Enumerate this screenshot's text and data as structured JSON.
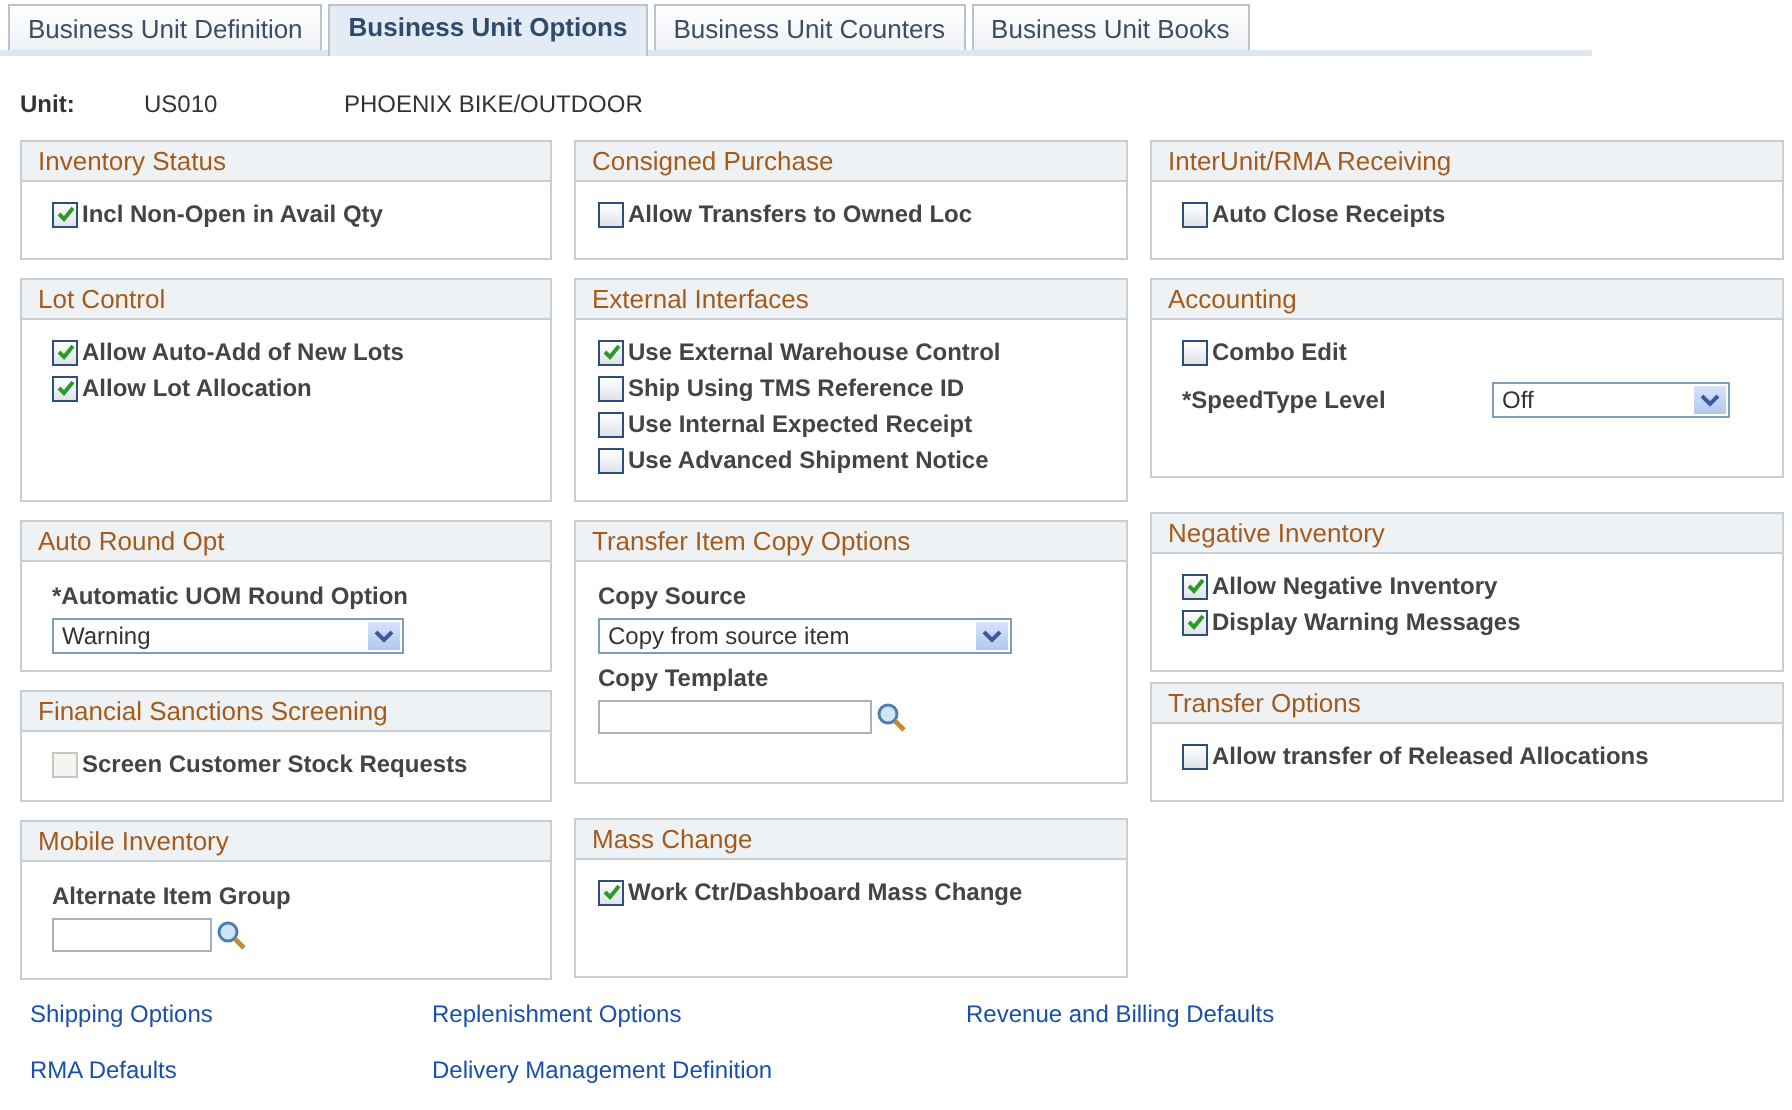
{
  "tabs": [
    {
      "label": "Business Unit Definition",
      "selected": false
    },
    {
      "label": "Business Unit Options",
      "selected": true
    },
    {
      "label": "Business Unit Counters",
      "selected": false
    },
    {
      "label": "Business Unit Books",
      "selected": false
    }
  ],
  "unit": {
    "label": "Unit:",
    "code": "US010",
    "description": "PHOENIX BIKE/OUTDOOR"
  },
  "columns": [
    {
      "groups": [
        {
          "title": "Inventory Status",
          "items": [
            {
              "kind": "checkbox",
              "label": "Incl Non-Open in Avail Qty",
              "checked": true,
              "disabled": false
            }
          ]
        },
        {
          "title": "Lot Control",
          "items": [
            {
              "kind": "checkbox",
              "label": "Allow Auto-Add of New Lots",
              "checked": true,
              "disabled": false
            },
            {
              "kind": "checkbox",
              "label": "Allow Lot Allocation",
              "checked": true,
              "disabled": false
            }
          ]
        },
        {
          "title": "Auto Round Opt",
          "items": [
            {
              "kind": "select",
              "label": "*Automatic UOM Round Option",
              "value": "Warning"
            }
          ]
        },
        {
          "title": "Financial Sanctions Screening",
          "items": [
            {
              "kind": "checkbox",
              "label": "Screen Customer Stock Requests",
              "checked": false,
              "disabled": true
            }
          ]
        },
        {
          "title": "Mobile Inventory",
          "items": [
            {
              "kind": "lookup",
              "label": "Alternate Item Group"
            }
          ]
        }
      ]
    },
    {
      "groups": [
        {
          "title": "Consigned Purchase",
          "items": [
            {
              "kind": "checkbox",
              "label": "Allow Transfers to Owned Loc",
              "checked": false,
              "disabled": false
            }
          ]
        },
        {
          "title": "External Interfaces",
          "items": [
            {
              "kind": "checkbox",
              "label": "Use External Warehouse Control",
              "checked": true,
              "disabled": false
            },
            {
              "kind": "checkbox",
              "label": "Ship Using TMS Reference ID",
              "checked": false,
              "disabled": false
            },
            {
              "kind": "checkbox",
              "label": "Use Internal Expected Receipt",
              "checked": false,
              "disabled": false
            },
            {
              "kind": "checkbox",
              "label": "Use Advanced Shipment Notice",
              "checked": false,
              "disabled": false
            }
          ]
        },
        {
          "title": "Transfer Item Copy Options",
          "items": [
            {
              "kind": "select",
              "label": "Copy Source",
              "value": "Copy from source item"
            },
            {
              "kind": "lookup",
              "label": "Copy Template"
            }
          ]
        },
        {
          "title": "Mass Change",
          "items": [
            {
              "kind": "checkbox",
              "label": "Work Ctr/Dashboard Mass Change",
              "checked": true,
              "disabled": false
            }
          ]
        }
      ]
    },
    {
      "groups": [
        {
          "title": "InterUnit/RMA Receiving",
          "items": [
            {
              "kind": "checkbox",
              "label": "Auto Close Receipts",
              "checked": false,
              "disabled": false
            }
          ]
        },
        {
          "title": "Accounting",
          "items": [
            {
              "kind": "checkbox",
              "label": "Combo Edit",
              "checked": false,
              "disabled": false
            },
            {
              "kind": "inline-select",
              "label": "*SpeedType Level",
              "value": "Off"
            }
          ]
        },
        {
          "title": "Negative Inventory",
          "items": [
            {
              "kind": "checkbox",
              "label": "Allow Negative Inventory",
              "checked": true,
              "disabled": false
            },
            {
              "kind": "checkbox",
              "label": "Display Warning Messages",
              "checked": true,
              "disabled": false
            }
          ]
        },
        {
          "title": "Transfer Options",
          "items": [
            {
              "kind": "checkbox",
              "label": "Allow transfer of Released Allocations",
              "checked": false,
              "disabled": false
            }
          ]
        }
      ]
    }
  ],
  "links": [
    [
      "Shipping Options",
      "RMA Defaults"
    ],
    [
      "Replenishment Options",
      "Delivery Management Definition"
    ],
    [
      "Revenue and Billing Defaults"
    ]
  ]
}
